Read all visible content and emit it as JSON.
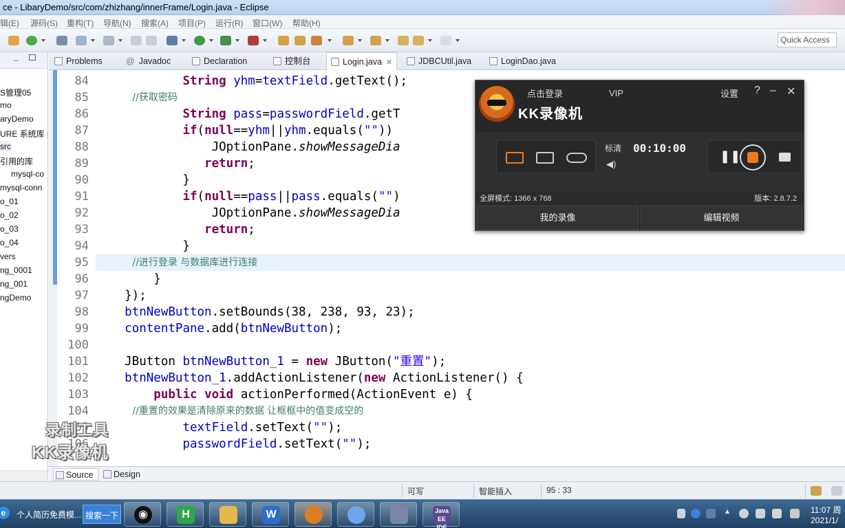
{
  "window": {
    "title": "ce - LibaryDemo/src/com/zhizhang/innerFrame/Login.java - Eclipse"
  },
  "menu": [
    "辑(E)",
    "源码(S)",
    "重构(T)",
    "导航(N)",
    "搜索(A)",
    "项目(P)",
    "运行(R)",
    "窗口(W)",
    "帮助(H)"
  ],
  "toolbar": {
    "quick_access": "Quick Access"
  },
  "package_explorer": {
    "items": [
      "S管理05",
      "mo",
      "aryDemo",
      "URE 系统库 [",
      "src",
      "引用的库",
      "mysql-co",
      "mysql-conn",
      "o_01",
      "o_02",
      "o_03",
      "o_04",
      "vers",
      "ng_0001",
      "ng_001",
      "ngDemo"
    ]
  },
  "tabs": [
    {
      "label": "Problems",
      "icon": "problems-icon"
    },
    {
      "label": "Javadoc",
      "icon": "at-icon"
    },
    {
      "label": "Declaration",
      "icon": "declaration-icon"
    },
    {
      "label": "控制台",
      "icon": "console-icon"
    },
    {
      "label": "Login.java",
      "icon": "java-file-icon"
    },
    {
      "label": "JDBCUtil.java",
      "icon": "java-file-icon"
    },
    {
      "label": "LoginDao.java",
      "icon": "java-file-icon"
    }
  ],
  "editor": {
    "lines": [
      {
        "num": "84",
        "text": "            String yhm=textField.getText();"
      },
      {
        "num": "85",
        "text": "            //获取密码"
      },
      {
        "num": "86",
        "text": "            String pass=passwordField.getT"
      },
      {
        "num": "87",
        "text": "            if(null==yhm||yhm.equals(\"\"))"
      },
      {
        "num": "88",
        "text": "                JOptionPane.showMessageDia"
      },
      {
        "num": "89",
        "text": "               return;"
      },
      {
        "num": "90",
        "text": "            }"
      },
      {
        "num": "91",
        "text": "            if(null==pass||pass.equals(\"\")"
      },
      {
        "num": "92",
        "text": "                JOptionPane.showMessageDia"
      },
      {
        "num": "93",
        "text": "               return;"
      },
      {
        "num": "94",
        "text": "            }"
      },
      {
        "num": "95",
        "text": "            //进行登录 与数据库进行连接"
      },
      {
        "num": "96",
        "text": "        }"
      },
      {
        "num": "97",
        "text": "    });"
      },
      {
        "num": "98",
        "text": "    btnNewButton.setBounds(38, 238, 93, 23);"
      },
      {
        "num": "99",
        "text": "    contentPane.add(btnNewButton);"
      },
      {
        "num": "100",
        "text": ""
      },
      {
        "num": "101",
        "text": "    JButton btnNewButton_1 = new JButton(\"重置\");"
      },
      {
        "num": "102",
        "text": "    btnNewButton_1.addActionListener(new ActionListener() {"
      },
      {
        "num": "103",
        "text": "        public void actionPerformed(ActionEvent e) {"
      },
      {
        "num": "104",
        "text": "            //重置的效果是清除原来的数据 让框框中的值变成空的"
      },
      {
        "num": "105",
        "text": "            textField.setText(\"\");"
      },
      {
        "num": "106",
        "text": "            passwordField.setText(\"\");"
      }
    ],
    "current_line": "95"
  },
  "editor_bottom_tabs": [
    "Source",
    "Design"
  ],
  "status": {
    "writable": "可写",
    "insert_mode": "智能插入",
    "position": "95 : 33"
  },
  "recorder": {
    "login": "点击登录",
    "vip": "VIP",
    "settings": "设置",
    "help": "?",
    "minimize": "–",
    "close": "✕",
    "app_name": "KK录像机",
    "quality": "标清",
    "timer": "00:10:00",
    "fullscreen_mode": "全屏模式: 1366 x 768",
    "version": "版本: 2.8.7.2",
    "my_recordings": "我的录像",
    "edit_video": "编辑视频",
    "accent_color": "#f07a1e"
  },
  "watermark": {
    "line1": "录制工具",
    "line2": "KK录像机"
  },
  "taskbar": {
    "start_text": "个人简历免费模...",
    "search_button": "搜索一下",
    "apps": [
      "qq-icon",
      "h-app-icon",
      "folder-icon",
      "wps-icon",
      "kk-recorder-icon",
      "cloud-icon",
      "paint-icon",
      "javaee-ide-icon"
    ],
    "clock_time": "11:07 周",
    "clock_date": "2021/1/"
  }
}
